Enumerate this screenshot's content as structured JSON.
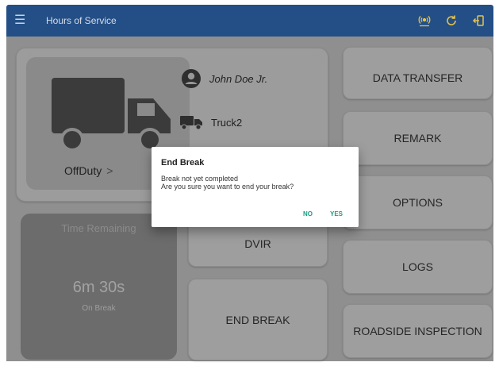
{
  "appbar": {
    "title": "Hours of Service",
    "icons": [
      "menu-icon",
      "antenna-icon",
      "refresh-icon",
      "logout-icon"
    ]
  },
  "status": {
    "label": "OffDuty",
    "chevron": ">"
  },
  "driver": {
    "name": "John Doe Jr.",
    "vehicle": "Truck2"
  },
  "timer": {
    "title": "Time Remaining",
    "value": "6m 30s",
    "subtitle": "On Break"
  },
  "center_buttons": {
    "dvir": "DVIR",
    "end_break": "END BREAK"
  },
  "right_buttons": {
    "data_transfer": "DATA TRANSFER",
    "remark": "REMARK",
    "options": "OPTIONS",
    "logs": "LOGS",
    "roadside": "ROADSIDE INSPECTION"
  },
  "dialog": {
    "title": "End Break",
    "message_line1": "Break not yet completed",
    "message_line2": "Are you sure you want to end your break?",
    "no_label": "NO",
    "yes_label": "YES"
  },
  "colors": {
    "appbar": "#244f86",
    "dialog_action": "#1b9a82",
    "accent_icons": "#e6c34a"
  }
}
